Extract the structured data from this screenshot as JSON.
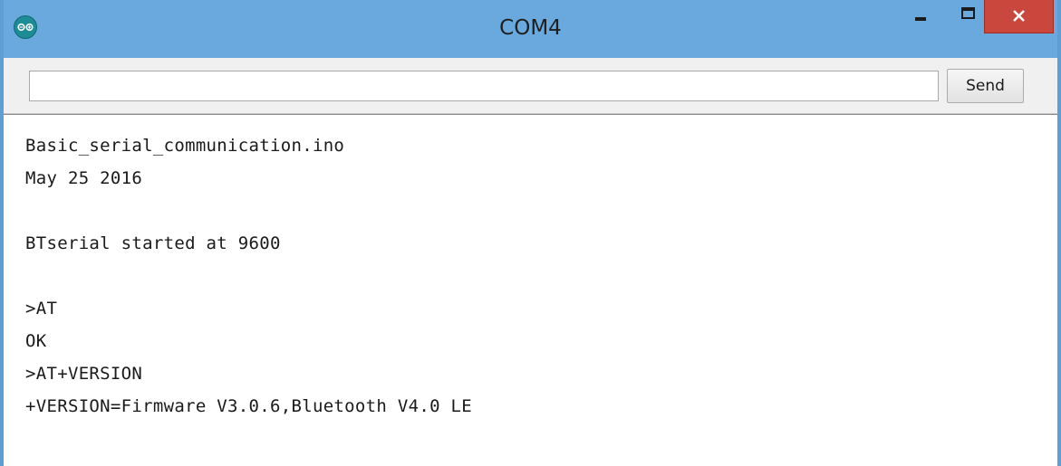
{
  "window": {
    "title": "COM4",
    "app_icon": "arduino-icon",
    "controls": [
      "minimize-icon",
      "maximize-icon",
      "close-icon"
    ],
    "accent_color": "#6aa9dd",
    "close_color": "#c9473c"
  },
  "input_bar": {
    "value": "",
    "send_label": "Send"
  },
  "serial_output": {
    "lines": [
      "Basic_serial_communication.ino",
      "May 25 2016",
      "",
      "BTserial started at 9600",
      "",
      ">AT",
      "OK",
      ">AT+VERSION",
      "+VERSION=Firmware V3.0.6,Bluetooth V4.0 LE"
    ]
  }
}
